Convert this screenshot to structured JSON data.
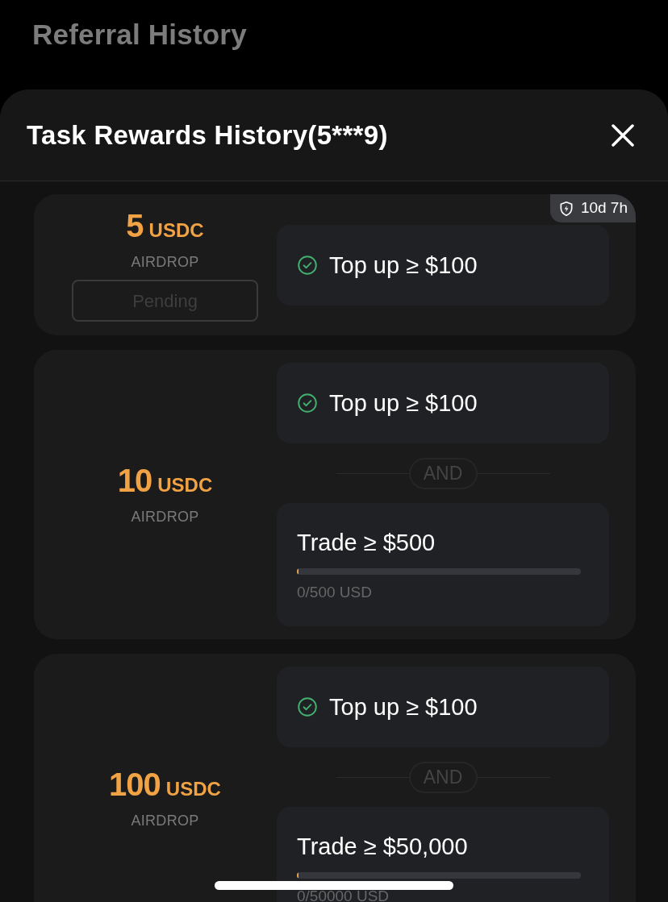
{
  "background": {
    "title": "Referral History"
  },
  "sheet": {
    "title": "Task Rewards History(5***9)"
  },
  "rewards": [
    {
      "amount": "5",
      "unit": "USDC",
      "type": "AIRDROP",
      "timer": "10d 7h",
      "button": {
        "label": "Pending",
        "disabled": true
      },
      "tasks": [
        {
          "kind": "check",
          "label": "Top up ≥ $100",
          "done": true
        }
      ]
    },
    {
      "amount": "10",
      "unit": "USDC",
      "type": "AIRDROP",
      "tasks": [
        {
          "kind": "check",
          "label": "Top up ≥ $100",
          "done": true
        },
        {
          "kind": "progress",
          "joiner": "AND",
          "label": "Trade ≥ $500",
          "level": 0,
          "reading": "0/500 USD"
        }
      ]
    },
    {
      "amount": "100",
      "unit": "USDC",
      "type": "AIRDROP",
      "tasks": [
        {
          "kind": "check",
          "label": "Top up ≥ $100",
          "done": true
        },
        {
          "kind": "progress",
          "joiner": "AND",
          "label": "Trade ≥ $50,000",
          "level": 0,
          "reading": "0/50000 USD"
        }
      ]
    }
  ]
}
